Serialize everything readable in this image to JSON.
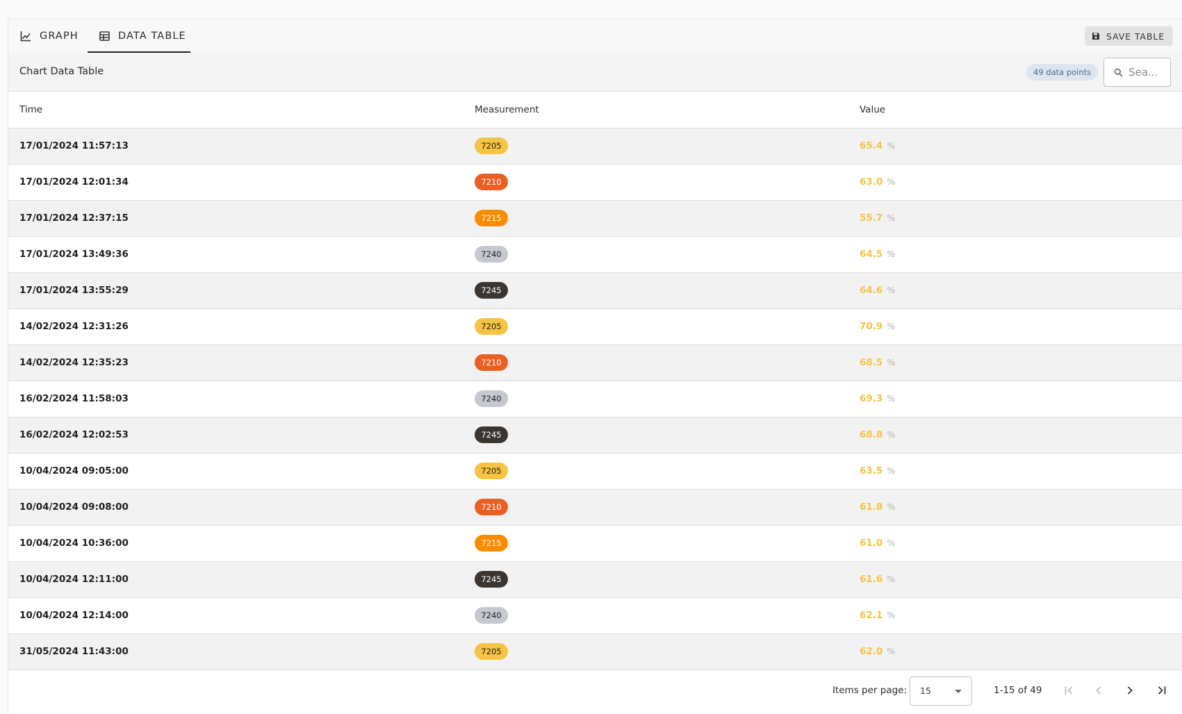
{
  "tabs": {
    "graph_label": "GRAPH",
    "data_table_label": "DATA TABLE"
  },
  "toolbar": {
    "save_label": "SAVE TABLE"
  },
  "header": {
    "title": "Chart Data Table",
    "badge": "49 data points",
    "search_placeholder": "Sea..."
  },
  "table": {
    "columns": [
      "Time",
      "Measurement",
      "Value"
    ],
    "rows": [
      {
        "time": "17/01/2024 11:57:13",
        "measurement": "7205",
        "value": "65.4",
        "unit": "%"
      },
      {
        "time": "17/01/2024 12:01:34",
        "measurement": "7210",
        "value": "63.0",
        "unit": "%"
      },
      {
        "time": "17/01/2024 12:37:15",
        "measurement": "7215",
        "value": "55.7",
        "unit": "%"
      },
      {
        "time": "17/01/2024 13:49:36",
        "measurement": "7240",
        "value": "64.5",
        "unit": "%"
      },
      {
        "time": "17/01/2024 13:55:29",
        "measurement": "7245",
        "value": "64.6",
        "unit": "%"
      },
      {
        "time": "14/02/2024 12:31:26",
        "measurement": "7205",
        "value": "70.9",
        "unit": "%"
      },
      {
        "time": "14/02/2024 12:35:23",
        "measurement": "7210",
        "value": "68.5",
        "unit": "%"
      },
      {
        "time": "16/02/2024 11:58:03",
        "measurement": "7240",
        "value": "69.3",
        "unit": "%"
      },
      {
        "time": "16/02/2024 12:02:53",
        "measurement": "7245",
        "value": "68.8",
        "unit": "%"
      },
      {
        "time": "10/04/2024 09:05:00",
        "measurement": "7205",
        "value": "63.5",
        "unit": "%"
      },
      {
        "time": "10/04/2024 09:08:00",
        "measurement": "7210",
        "value": "61.8",
        "unit": "%"
      },
      {
        "time": "10/04/2024 10:36:00",
        "measurement": "7215",
        "value": "61.0",
        "unit": "%"
      },
      {
        "time": "10/04/2024 12:11:00",
        "measurement": "7245",
        "value": "61.6",
        "unit": "%"
      },
      {
        "time": "10/04/2024 12:14:00",
        "measurement": "7240",
        "value": "62.1",
        "unit": "%"
      },
      {
        "time": "31/05/2024 11:43:00",
        "measurement": "7205",
        "value": "62.0",
        "unit": "%"
      }
    ]
  },
  "measurement_colors": {
    "7205": {
      "bg": "#f6c342",
      "fg": "#1f1f1f"
    },
    "7210": {
      "bg": "#ec5f22",
      "fg": "#ffffff"
    },
    "7215": {
      "bg": "#fb8c00",
      "fg": "#ffffff"
    },
    "7240": {
      "bg": "#c5c8ce",
      "fg": "#1f1f1f"
    },
    "7245": {
      "bg": "#3b3532",
      "fg": "#ffffff"
    }
  },
  "colors": {
    "value_text": "#f6c342"
  },
  "paginator": {
    "items_per_page_label": "Items per page:",
    "items_per_page": "15",
    "range_label": "1-15 of 49"
  },
  "icons": [
    "chart-line-icon",
    "table-icon",
    "save-icon",
    "search-icon",
    "first-page-icon",
    "prev-page-icon",
    "next-page-icon",
    "last-page-icon"
  ]
}
